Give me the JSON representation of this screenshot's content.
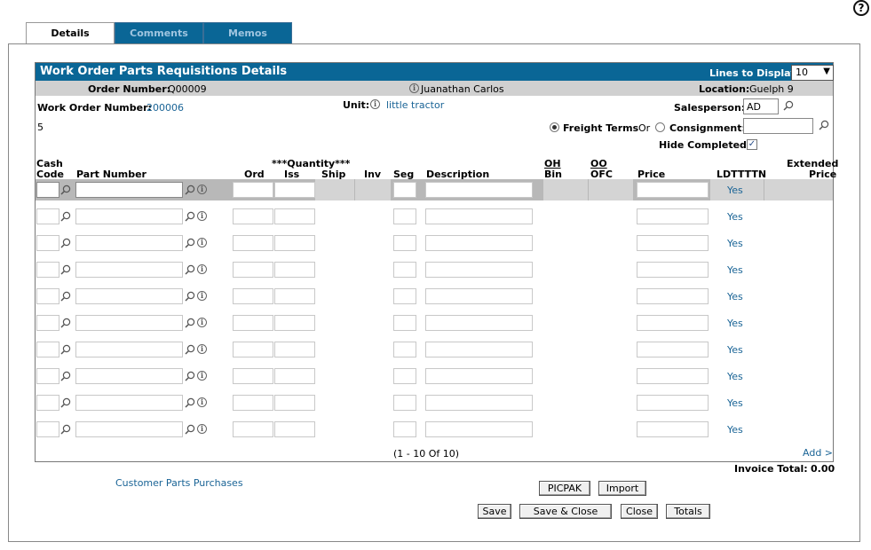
{
  "tabs": [
    {
      "label": "Details",
      "active": true
    },
    {
      "label": "Comments",
      "active": false
    },
    {
      "label": "Memos",
      "active": false
    }
  ],
  "panel": {
    "title": "Work Order Parts Requisitions Details",
    "lines_to_display_label": "Lines to Display",
    "lines_to_display_value": "10"
  },
  "info": {
    "order_number_label": "Order Number:",
    "order_number": "Q00009",
    "customer_name": "Juanathan Carlos",
    "location_label": "Location:",
    "location": "Guelph 9"
  },
  "form": {
    "work_order_number_label": "Work Order Number:",
    "work_order_number": "200006",
    "unit_label": "Unit:",
    "unit": "little tractor",
    "salesperson_label": "Salesperson:",
    "salesperson": "AD",
    "count_text": "5",
    "freight_terms_label": "Freight Terms",
    "or_text": "Or",
    "consignment_label": "Consignment:",
    "consignment": "",
    "hide_completed_label": "Hide Completed:",
    "hide_completed_checked": "✓"
  },
  "columns": {
    "cash_code": "Cash",
    "cash_code2": "Code",
    "part_number": "Part Number",
    "quantity_group": "***Quantity***",
    "ord": "Ord",
    "iss": "Iss",
    "ship": "Ship",
    "inv": "Inv",
    "seg": "Seg",
    "description": "Description",
    "oh": "OH",
    "bin": "Bin",
    "oo": "OO",
    "ofc": "OFC",
    "price": "Price",
    "ldttttn": "LDTTTTN",
    "extended": "Extended",
    "extended2": "Price"
  },
  "rows": [
    {
      "ldttttn": "Yes"
    },
    {
      "ldttttn": "Yes"
    },
    {
      "ldttttn": "Yes"
    },
    {
      "ldttttn": "Yes"
    },
    {
      "ldttttn": "Yes"
    },
    {
      "ldttttn": "Yes"
    },
    {
      "ldttttn": "Yes"
    },
    {
      "ldttttn": "Yes"
    },
    {
      "ldttttn": "Yes"
    },
    {
      "ldttttn": "Yes"
    }
  ],
  "pagination": "(1 - 10 Of 10)",
  "add_link": "Add >",
  "invoice_total_label": "Invoice Total:",
  "invoice_total": "0.00",
  "customer_parts_link": "Customer Parts Purchases",
  "buttons": {
    "picpak": "PICPAK",
    "import": "Import",
    "save": "Save",
    "save_close": "Save & Close",
    "close": "Close",
    "totals": "Totals"
  },
  "help_symbol": "?",
  "info_symbol": "i"
}
